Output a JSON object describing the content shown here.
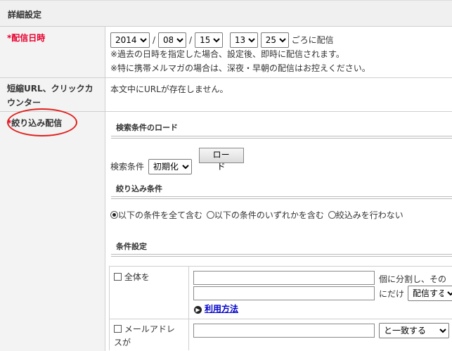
{
  "section": {
    "title": "詳細設定"
  },
  "delivery": {
    "label": "配信日時",
    "required_mark": "*",
    "year": "2014",
    "month": "08",
    "day": "15",
    "hour": "13",
    "minute": "25",
    "separator": "/",
    "suffix": "ごろに配信",
    "note1": "※過去の日時を指定した場合、設定後、即時に配信されます。",
    "note2": "※特に携帯メルマガの場合は、深夜・早朝の配信はお控えください。"
  },
  "short_url": {
    "label_line1": "短縮URL、クリックカ",
    "label_line2": "ウンター",
    "value": "本文中にURLが存在しません。"
  },
  "filter": {
    "label": "絞り込み配信",
    "required_mark": "*",
    "load_heading": "検索条件のロード",
    "search_label": "検索条件",
    "search_selected": "初期化",
    "load_button": "ロード",
    "filter_heading": "絞り込み条件",
    "radio_all": "以下の条件を全て含む",
    "radio_any": "以下の条件のいずれかを含む",
    "radio_none": "絞込みを行わない",
    "cond_heading": "条件設定",
    "cond_all_label": "全体を",
    "split_text": "個に分割し、その",
    "only_text": "にだけ",
    "deliver_select": "配信する",
    "usage_link": "利用方法",
    "email_label_line1": "メールアドレ",
    "email_label_line2": "スが",
    "match_select": "と一致する"
  }
}
